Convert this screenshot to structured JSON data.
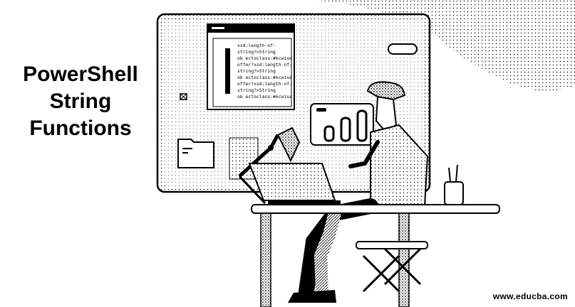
{
  "title": {
    "line1": "PowerShell",
    "line2": "String",
    "line3": "Functions"
  },
  "watermark": "www.educba.com",
  "code_window": {
    "lines": [
      "xsd:length-of-",
      "string?>String",
      "ob ectoclass:#kcwise",
      "offer?xsd:length-of-",
      "string?>String",
      "ob ectoclass:#kcwise",
      "offer?xsd:length-of-",
      "string?>String",
      "ob ectoclass:#kcwise"
    ]
  },
  "colors": {
    "ink": "#000000",
    "background": "#ffffff"
  }
}
